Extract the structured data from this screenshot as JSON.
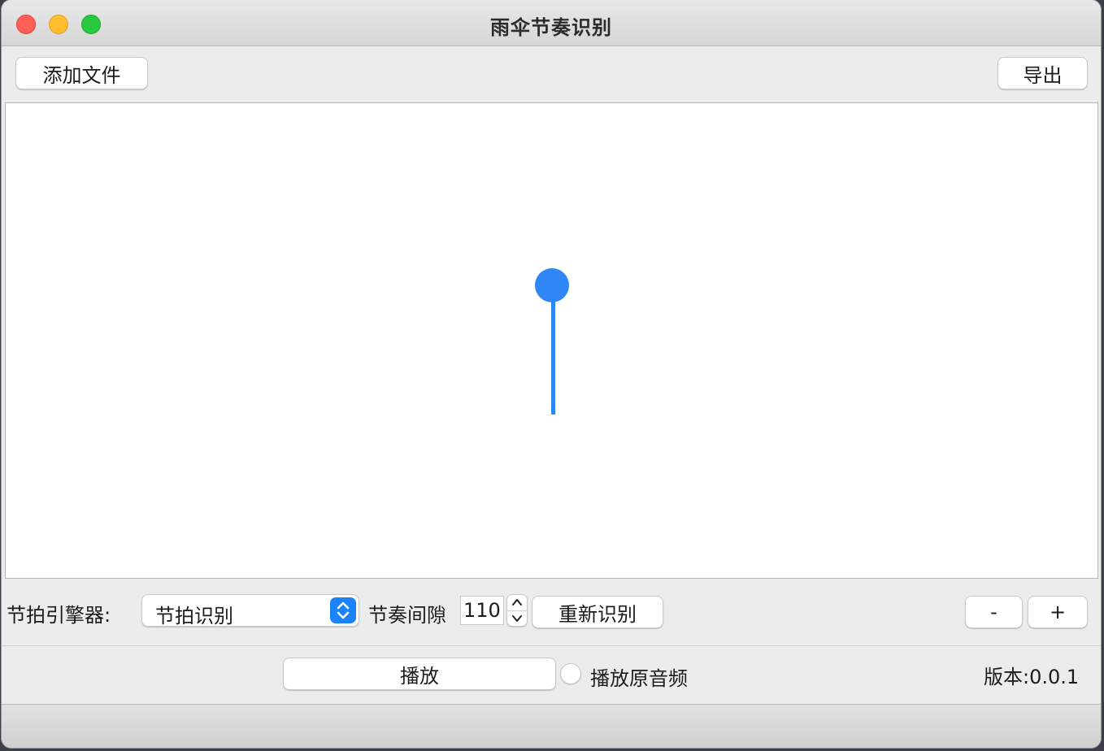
{
  "window": {
    "title": "雨伞节奏识别"
  },
  "toolbar": {
    "add_file_label": "添加文件",
    "export_label": "导出"
  },
  "controls": {
    "engine_label": "节拍引擎器:",
    "engine_select_value": "节拍识别",
    "interval_label": "节奏间隙",
    "interval_value": "110",
    "reidentify_label": "重新识别",
    "zoom_out_label": "-",
    "zoom_in_label": "+"
  },
  "playback": {
    "play_label": "播放",
    "play_original_label": "播放原音频",
    "version_text": "版本:0.0.1"
  },
  "colors": {
    "accent": "#2f86f6",
    "select_accent": "#1a82fb",
    "close": "#fe5f57",
    "minimize": "#febc2e",
    "maximize": "#28c840"
  }
}
